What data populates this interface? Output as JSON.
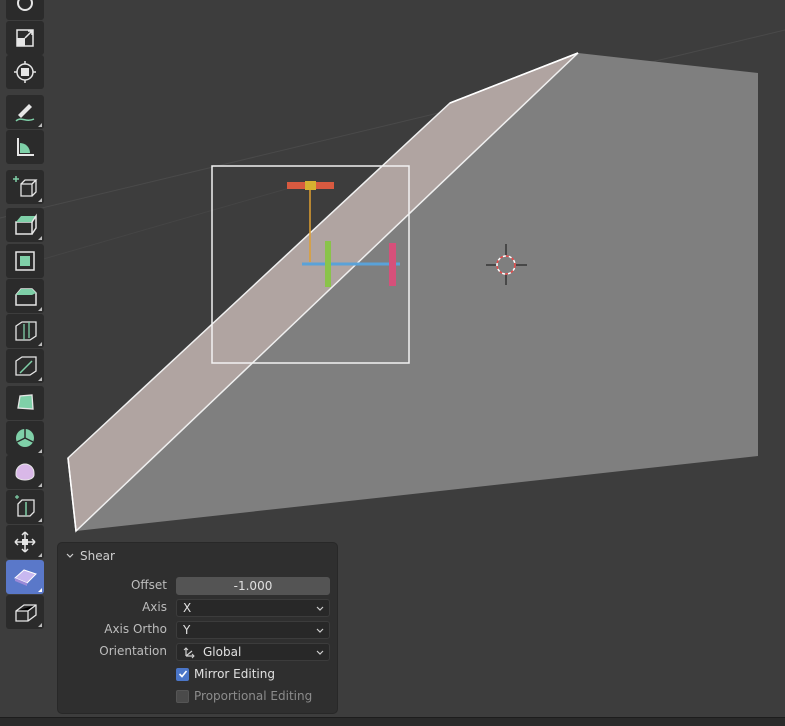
{
  "toolbar": {
    "tools": [
      {
        "name": "rotate-tool",
        "icon": "rotate-icon",
        "active": false
      },
      {
        "name": "scale-tool",
        "icon": "scale-icon",
        "active": false
      },
      {
        "name": "transform-tool",
        "icon": "transform-icon",
        "active": false
      },
      {
        "name": "annotate-tool",
        "icon": "annotate-icon",
        "active": false
      },
      {
        "name": "measure-tool",
        "icon": "measure-icon",
        "active": false
      },
      {
        "name": "add-cube-tool",
        "icon": "add-cube-icon",
        "active": false
      },
      {
        "name": "extrude-tool",
        "icon": "extrude-icon",
        "active": false
      },
      {
        "name": "inset-faces-tool",
        "icon": "inset-icon",
        "active": false
      },
      {
        "name": "bevel-tool",
        "icon": "bevel-icon",
        "active": false
      },
      {
        "name": "loop-cut-tool",
        "icon": "loop-cut-icon",
        "active": false
      },
      {
        "name": "knife-tool",
        "icon": "knife-icon",
        "active": false
      },
      {
        "name": "poly-build-tool",
        "icon": "poly-build-icon",
        "active": false
      },
      {
        "name": "spin-tool",
        "icon": "spin-icon",
        "active": false
      },
      {
        "name": "smooth-tool",
        "icon": "smooth-icon",
        "active": false
      },
      {
        "name": "edge-slide-tool",
        "icon": "edge-slide-icon",
        "active": false
      },
      {
        "name": "shrink-fatten-tool",
        "icon": "shrink-fatten-icon",
        "active": false
      },
      {
        "name": "shear-tool",
        "icon": "shear-icon",
        "active": true
      },
      {
        "name": "rip-region-tool",
        "icon": "rip-region-icon",
        "active": false
      }
    ]
  },
  "operator_panel": {
    "title": "Shear",
    "offset_label": "Offset",
    "offset_value": "-1.000",
    "axis_label": "Axis",
    "axis_value": "X",
    "axis_ortho_label": "Axis Ortho",
    "axis_ortho_value": "Y",
    "orientation_label": "Orientation",
    "orientation_value": "Global",
    "mirror_editing_label": "Mirror Editing",
    "mirror_editing_checked": true,
    "proportional_editing_label": "Proportional Editing",
    "proportional_editing_checked": false
  },
  "colors": {
    "viewport_bg": "#3d3d3d",
    "mesh_face": "#7f7f7f",
    "selected_face": "#b0a4a1",
    "active_tool": "#5a78c9",
    "gizmo_x": "#e05a4a",
    "gizmo_y": "#8ac34a",
    "gizmo_z": "#5a9ed6"
  }
}
